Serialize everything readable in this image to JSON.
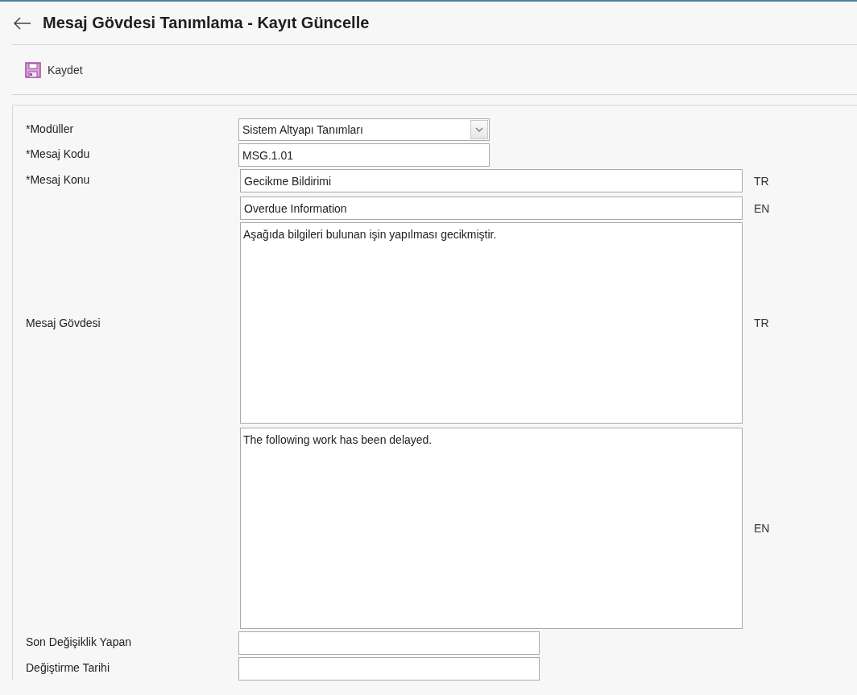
{
  "title": "Mesaj Gövdesi Tanımlama - Kayıt Güncelle",
  "toolbar": {
    "save_label": "Kaydet"
  },
  "form": {
    "rows": [
      {
        "label": "*Modüller",
        "kind": "select",
        "fields": [
          {
            "value": "Sistem Altyapı Tanımları"
          }
        ]
      },
      {
        "label": "*Mesaj Kodu",
        "kind": "text",
        "fields": [
          {
            "value": "MSG.1.01"
          }
        ]
      },
      {
        "label": "*Mesaj Konu",
        "kind": "localized",
        "fields": [
          {
            "value": "Gecikme Bildirimi",
            "lang": "TR"
          },
          {
            "value": "Overdue Information",
            "lang": "EN"
          }
        ]
      },
      {
        "label": "Mesaj Gövdesi",
        "kind": "textarea",
        "fields": [
          {
            "value": "Aşağıda bilgileri bulunan işin yapılması gecikmiştir.",
            "lang": "TR"
          },
          {
            "value": "The following work has been delayed.",
            "lang": "EN"
          }
        ]
      },
      {
        "label": "Son Değişiklik Yapan",
        "kind": "text_mid"
      },
      {
        "label": "Değiştirme Tarihi",
        "kind": "text_mid"
      }
    ]
  }
}
